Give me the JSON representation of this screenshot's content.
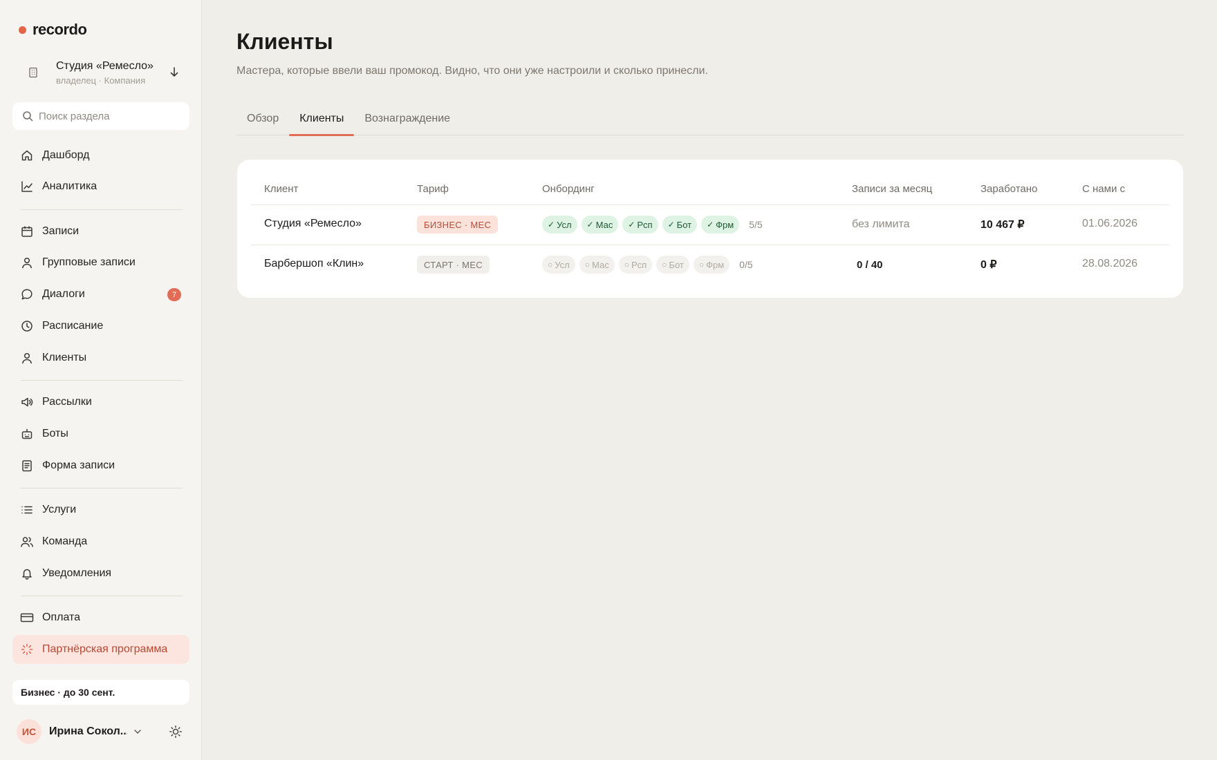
{
  "brand": {
    "name": "recordo",
    "accent": "#e4644a"
  },
  "org": {
    "name": "Студия «Ремесло»",
    "role": "владелец · Компания"
  },
  "search": {
    "placeholder": "Поиск раздела"
  },
  "nav": [
    {
      "label": "Дашборд",
      "icon": "home-icon"
    },
    {
      "label": "Аналитика",
      "icon": "chart-line-icon"
    },
    {
      "label": "Записи",
      "icon": "calendar-icon"
    },
    {
      "label": "Групповые записи",
      "icon": "user-icon"
    },
    {
      "label": "Диалоги",
      "icon": "chat-bubble-icon",
      "badge": "7"
    },
    {
      "label": "Расписание",
      "icon": "clock-icon"
    },
    {
      "label": "Клиенты",
      "icon": "user-icon"
    },
    {
      "label": "Рассылки",
      "icon": "megaphone-icon"
    },
    {
      "label": "Боты",
      "icon": "bot-icon"
    },
    {
      "label": "Форма записи",
      "icon": "form-document-icon"
    },
    {
      "label": "Услуги",
      "icon": "list-icon"
    },
    {
      "label": "Команда",
      "icon": "users-icon"
    },
    {
      "label": "Уведомления",
      "icon": "bell-icon"
    },
    {
      "label": "Оплата",
      "icon": "credit-card-icon"
    },
    {
      "label": "Партнёрская программа",
      "icon": "sparkle-icon",
      "active": true
    }
  ],
  "plan": {
    "label": "Бизнес · до 30 сент."
  },
  "user": {
    "initials": "ИС",
    "name": "Ирина Сокол..."
  },
  "page": {
    "title": "Клиенты",
    "subtitle": "Мастера, которые ввели ваш промокод. Видно, что они уже настроили и сколько принесли."
  },
  "tabs": [
    {
      "label": "Обзор",
      "active": false
    },
    {
      "label": "Клиенты",
      "active": true
    },
    {
      "label": "Вознаграждение",
      "active": false
    }
  ],
  "table": {
    "columns": [
      "Клиент",
      "Тариф",
      "Онбординг",
      "Записи за месяц",
      "Заработано",
      "С нами с"
    ],
    "rows": [
      {
        "client": "Студия «Ремесло»",
        "tariff": "БИЗНЕС · МЕС",
        "tariff_kind": "business",
        "steps": [
          {
            "label": "Усл",
            "mark": "✓",
            "done": true
          },
          {
            "label": "Мас",
            "mark": "✓",
            "done": true
          },
          {
            "label": "Рсп",
            "mark": "✓",
            "done": true
          },
          {
            "label": "Бот",
            "mark": "✓",
            "done": true
          },
          {
            "label": "Фрм",
            "mark": "✓",
            "done": true
          }
        ],
        "steps_count": "5/5",
        "records": "без лимита",
        "earned": "10 467 ₽",
        "since": "01.06.2026"
      },
      {
        "client": "Барбершоп «Клин»",
        "tariff": "СТАРТ · МЕС",
        "tariff_kind": "start",
        "steps": [
          {
            "label": "Усл",
            "mark": "○",
            "done": false
          },
          {
            "label": "Мас",
            "mark": "○",
            "done": false
          },
          {
            "label": "Рсп",
            "mark": "○",
            "done": false
          },
          {
            "label": "Бот",
            "mark": "○",
            "done": false
          },
          {
            "label": "Фрм",
            "mark": "○",
            "done": false
          }
        ],
        "steps_count": "0/5",
        "records": "0 / 40",
        "earned": "0 ₽",
        "since": "28.08.2026"
      }
    ]
  }
}
